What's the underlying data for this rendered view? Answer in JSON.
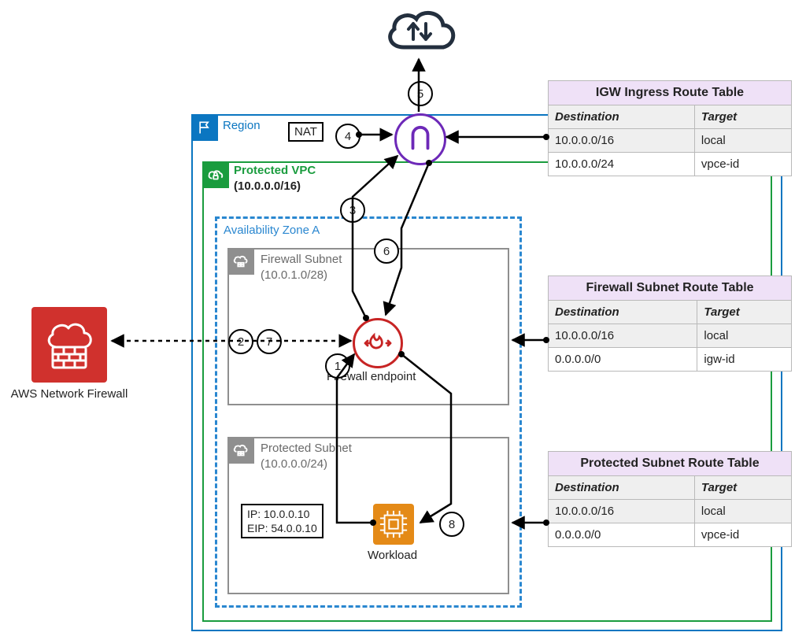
{
  "region": {
    "label": "Region",
    "nat_label": "NAT"
  },
  "vpc": {
    "title": "Protected VPC",
    "cidr": "(10.0.0.0/16)"
  },
  "az": {
    "label": "Availability Zone A"
  },
  "firewall_subnet": {
    "title": "Firewall Subnet",
    "cidr": "(10.0.1.0/28)"
  },
  "protected_subnet": {
    "title": "Protected Subnet",
    "cidr": "(10.0.0.0/24)"
  },
  "endpoint": {
    "label": "Firewall endpoint"
  },
  "workload": {
    "label": "Workload",
    "ip": "IP: 10.0.0.10",
    "eip": "EIP: 54.0.0.10"
  },
  "anf": {
    "label": "AWS Network Firewall"
  },
  "steps": {
    "1": "1",
    "2": "2",
    "3": "3",
    "4": "4",
    "5": "5",
    "6": "6",
    "7": "7",
    "8": "8"
  },
  "route_tables": {
    "igw": {
      "title": "IGW Ingress Route Table",
      "headers": {
        "dest": "Destination",
        "target": "Target"
      },
      "rows": [
        {
          "dest": "10.0.0.0/16",
          "target": "local"
        },
        {
          "dest": "10.0.0.0/24",
          "target": "vpce-id"
        }
      ]
    },
    "fw": {
      "title": "Firewall Subnet Route Table",
      "headers": {
        "dest": "Destination",
        "target": "Target"
      },
      "rows": [
        {
          "dest": "10.0.0.0/16",
          "target": "local"
        },
        {
          "dest": "0.0.0.0/0",
          "target": "igw-id"
        }
      ]
    },
    "prot": {
      "title": "Protected Subnet Route Table",
      "headers": {
        "dest": "Destination",
        "target": "Target"
      },
      "rows": [
        {
          "dest": "10.0.0.0/16",
          "target": "local"
        },
        {
          "dest": "0.0.0.0/0",
          "target": "vpce-id"
        }
      ]
    }
  }
}
